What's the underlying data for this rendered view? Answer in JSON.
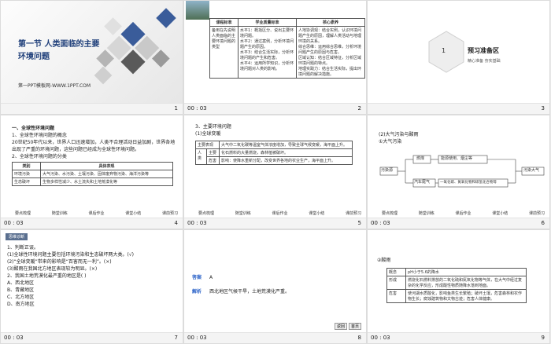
{
  "slides": [
    {
      "num": "1",
      "title": "第一节 人类面临的主要环境问题",
      "title_line1": "第一节 人类面临的主要",
      "title_line2": "环境问题",
      "site": "第一PPT模板网-WWW.1PPT.COM",
      "time": ""
    },
    {
      "num": "2",
      "time": "00 : 03",
      "table": {
        "headers": [
          "课程标准",
          "学业质量标准",
          "核心素养"
        ],
        "col1": "备用在先说明人类面临的主要环境问题的类型",
        "col2": [
          "水平1：概括区分、说出主要环境问题。",
          "水平2：通过案例，分析环境问题产生的原因。",
          "水平3：结合生活实际，分析环境问题的产生和危害。",
          "水平4：运用所学知识，分析环境问题对人类的影响。"
        ],
        "col3": [
          "人地协调观：结合实例，认识环境问题产生的原因，理解人类活动与地理环境的关系。",
          "综合思维：运用综合思维，分析环境问题产生的原因与危害。",
          "区域认知：结合区域特征，分析区域环境问题的特点。",
          "地理实践力：结合生活实际，提出环境问题的解决措施。"
        ]
      }
    },
    {
      "num": "3",
      "time": "",
      "hex_label": "1",
      "heading": "预习准备区",
      "sub": "精心准备 夯实基础"
    },
    {
      "num": "4",
      "time": "00 : 03",
      "h1": "一、全球性环境问题",
      "p1": "1、全球性环境问题的概念",
      "p2": "20世纪50年代以来，世界人口迅速增加，人类不合理活动日益加剧，世界各地出现了严重的环境问题，这些问题已经成为全球性环境问题。",
      "p3": "2、全球性环境问题的分类",
      "table": {
        "headers": [
          "类别",
          "具体表现"
        ],
        "rows": [
          [
            "环境污染",
            "大气污染、水污染、土壤污染、固体废弃物污染、海洋污染等"
          ],
          [
            "生态破坏",
            "生物多样性减少、水土流失和土地荒漠化等"
          ]
        ]
      },
      "links": [
        "要点梳理",
        "随堂训练",
        "课后作业",
        "课堂小结",
        "课前预习"
      ]
    },
    {
      "num": "5",
      "time": "00 : 03",
      "h1": "3、主要环境问题",
      "h2": "(1)全球变暖",
      "rows": [
        {
          "label": "主要表现",
          "text": "大气中二氧化碳等温室气体浓度增加，导致全球气候变暖，海平面上升。"
        },
        {
          "label": "人类",
          "sub": "主要",
          "text": "化石燃料的大量燃烧，森林植被破坏。"
        },
        {
          "label": "影响",
          "sub": "危害",
          "text": "使降水重新分配，改变世界各地的农业生产，海平面上升。"
        }
      ],
      "links": [
        "要点梳理",
        "随堂训练",
        "课后作业",
        "课堂小结",
        "课前预习"
      ]
    },
    {
      "num": "6",
      "time": "00 : 03",
      "h1": "(2)大气污染与酸雨",
      "h2": "①大气污染",
      "flow": [
        "污染源",
        "燃煤",
        "能源使用、烟尘等",
        "汽车尾气",
        "一氧化碳、氮氧化物和碳氢化合物等",
        "污染大气"
      ],
      "links": [
        "要点梳理",
        "随堂训练",
        "课后作业",
        "课堂小结",
        "课前预习"
      ]
    },
    {
      "num": "7",
      "time": "00 : 03",
      "badge": "思维诊断",
      "q": "1、判断正误。",
      "items": [
        "(1)全球性环境问题主要包括环境污染和生态破坏两大类。(√)",
        "(2)“全球变暖”带来的影响是“百害而无一利”。(×)",
        "(3)酸雨在我国北方地区表现较为明显。(×)"
      ],
      "q2": "2、我国土地荒漠化最严重的地区是(    )",
      "options": [
        "A、西北地区",
        "B、青藏地区",
        "C、北方地区",
        "D、南方地区"
      ]
    },
    {
      "num": "8",
      "time": "00 : 03",
      "answer_label": "答案",
      "answer": "A",
      "analysis_label": "解析",
      "analysis": "西北地区气候干旱，土地荒漠化严重。",
      "btns": [
        "返回",
        "首页"
      ]
    },
    {
      "num": "9",
      "time": "00 : 03",
      "h1": "②酸雨",
      "rows": [
        {
          "label": "概念",
          "text": "pH小于5.6的降水"
        },
        {
          "label": "形成",
          "text": "燃烧化石燃料排放的二氧化硫和氮氧化物等气体，在大气中经过复杂的化学反应，形成酸性物质随降水落到地面。"
        },
        {
          "label": "危害",
          "text": "使河湖水质酸化，影响鱼类生长繁殖；破坏土壤，危害森林和农作物生长；腐蚀建筑物和文物古迹；危害人体健康。"
        }
      ]
    }
  ]
}
